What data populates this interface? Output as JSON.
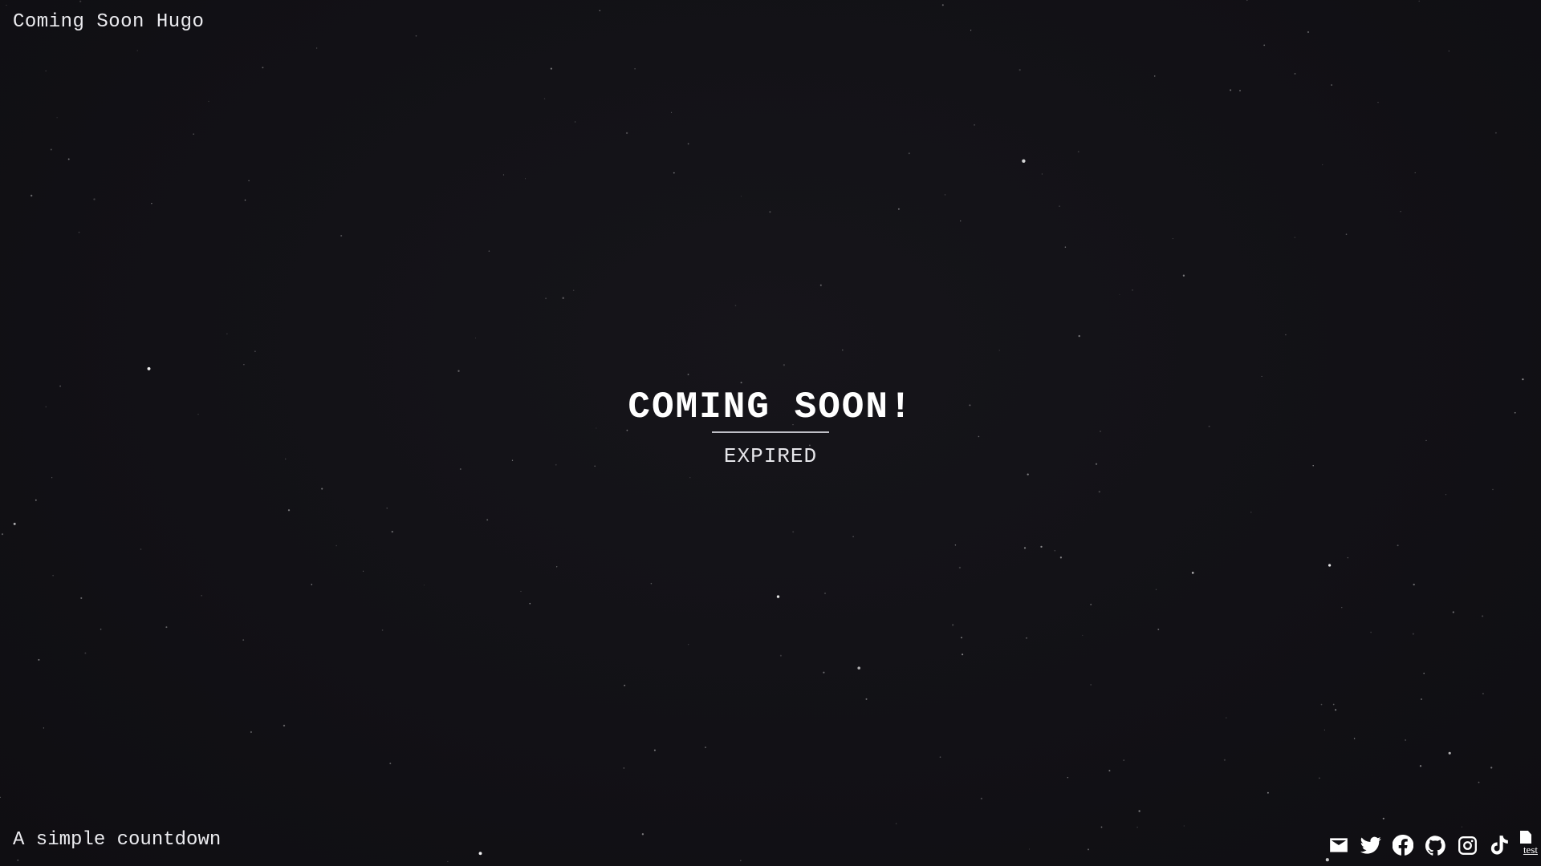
{
  "header": {
    "site_title": "Coming Soon Hugo"
  },
  "hero": {
    "title": "COMING SOON!",
    "countdown_status": "EXPIRED"
  },
  "footer": {
    "tagline": "A simple countdown",
    "social_links": [
      {
        "icon": "mail-icon",
        "name": "email"
      },
      {
        "icon": "twitter-icon",
        "name": "twitter"
      },
      {
        "icon": "facebook-icon",
        "name": "facebook"
      },
      {
        "icon": "github-icon",
        "name": "github"
      },
      {
        "icon": "instagram-icon",
        "name": "instagram"
      },
      {
        "icon": "tiktok-icon",
        "name": "tiktok"
      }
    ],
    "broken_image_alt": "test"
  },
  "colors": {
    "background": "#121116",
    "text": "#ececf0",
    "accent_rule": "#bfbfc6"
  }
}
